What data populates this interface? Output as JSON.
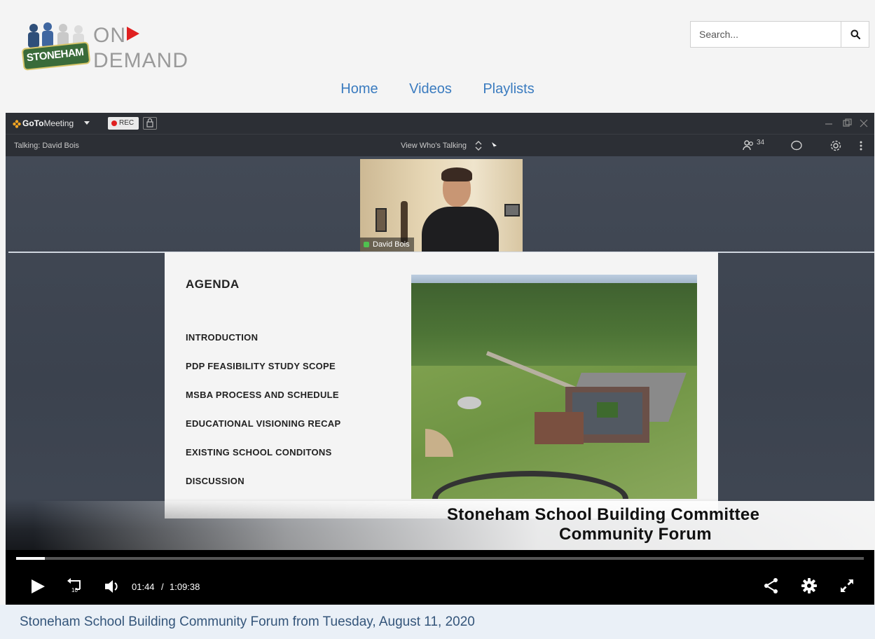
{
  "brand": {
    "badge_text": "STONEHAM",
    "on_text": "ON",
    "demand_text": "DEMAND"
  },
  "search": {
    "placeholder": "Search..."
  },
  "nav": {
    "items": [
      {
        "label": "Home"
      },
      {
        "label": "Videos"
      },
      {
        "label": "Playlists"
      }
    ]
  },
  "meeting": {
    "app_brand_bold": "GoTo",
    "app_brand_rest": "Meeting",
    "rec_label": "REC",
    "talking_label": "Talking: David Bois",
    "view_label": "View Who's Talking",
    "attendee_count": "34",
    "cam_name": "David Bois"
  },
  "slide": {
    "title": "AGENDA",
    "items": [
      "INTRODUCTION",
      "PDP FEASIBILITY STUDY SCOPE",
      "MSBA PROCESS AND SCHEDULE",
      "EDUCATIONAL VISIONING RECAP",
      "EXISTING SCHOOL CONDITONS",
      "DISCUSSION"
    ]
  },
  "caption": {
    "line1": "Stoneham School Building Committee",
    "line2": "Community Forum"
  },
  "player": {
    "current_time": "01:44",
    "separator": "/",
    "duration": "1:09:38",
    "progress_percent": 3.4,
    "replay_seconds": "10"
  },
  "video": {
    "title": "Stoneham School Building Community Forum from Tuesday, August 11, 2020"
  },
  "colors": {
    "nav_link": "#3a7bbf",
    "title_text": "#34557a",
    "title_bg": "#eaf0f7",
    "rec_dot": "#e02020"
  }
}
